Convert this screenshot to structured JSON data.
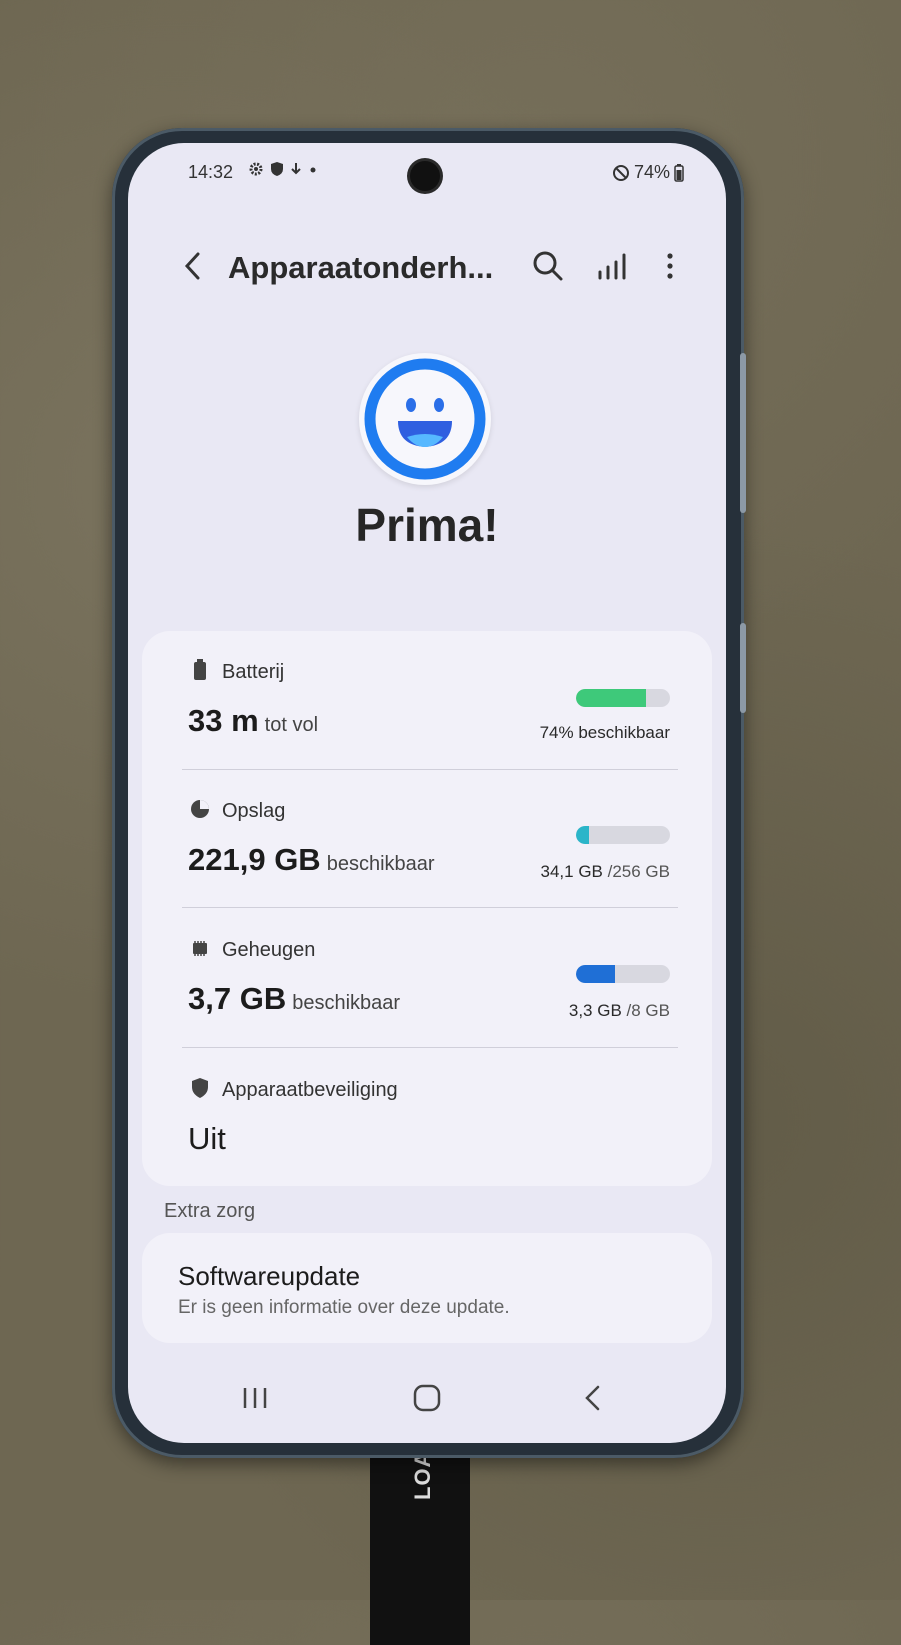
{
  "statusbar": {
    "time": "14:32",
    "battery": "74%"
  },
  "appbar": {
    "title": "Apparaatonderh...",
    "back_icon": "back-arrow-icon",
    "search_icon": "search-icon",
    "stats_icon": "bar-chart-icon",
    "more_icon": "more-vertical-icon"
  },
  "status": {
    "title": "Prima!",
    "icon": "smiley-face-icon"
  },
  "battery": {
    "label": "Batterij",
    "value": "33 m",
    "suffix": "tot vol",
    "caption": "74% beschikbaar",
    "level": 0.74,
    "color": "#3ec97a"
  },
  "storage": {
    "label": "Opslag",
    "value": "221,9 GB",
    "suffix": "beschikbaar",
    "used": "34,1 GB",
    "total": "/256 GB",
    "level": 0.133,
    "color": "#2bb5c9"
  },
  "memory": {
    "label": "Geheugen",
    "value": "3,7 GB",
    "suffix": "beschikbaar",
    "used": "3,3 GB",
    "total": "/8 GB",
    "level": 0.41,
    "color": "#1f6fd6"
  },
  "security": {
    "label": "Apparaatbeveiliging",
    "value": "Uit"
  },
  "extra": {
    "label": "Extra zorg"
  },
  "update": {
    "title": "Softwareupdate",
    "subtitle": "Er is geen informatie over deze update."
  },
  "cable": {
    "text": "LOAD"
  }
}
